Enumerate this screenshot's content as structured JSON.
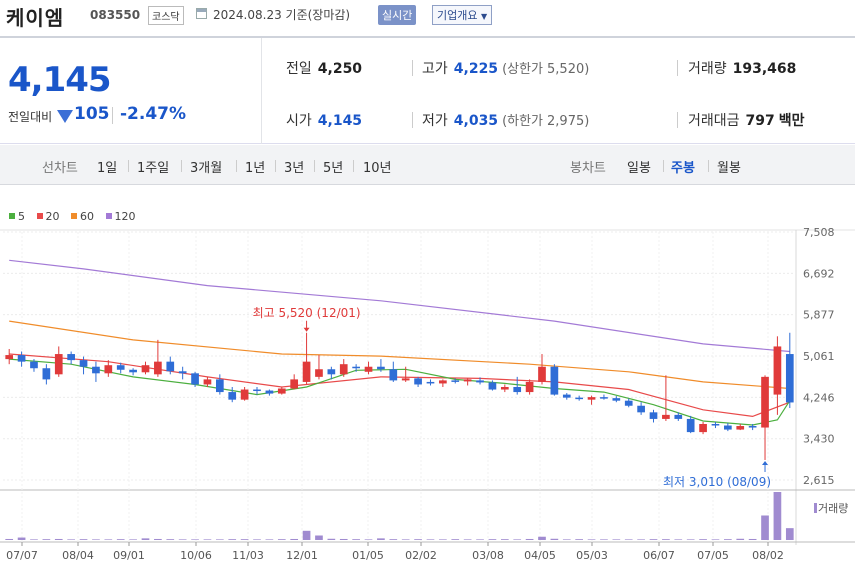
{
  "header": {
    "name": "케이엠",
    "code": "083550",
    "market": "코스닥",
    "date": "2024.08.23",
    "basis": "기준(장마감)",
    "realtime_label": "실시간",
    "company_label": "기업개요"
  },
  "price": {
    "current": "4,145",
    "change_label": "전일대비",
    "change": "105",
    "change_pct": "-2.47%",
    "direction": "down"
  },
  "stats": {
    "prev_label": "전일",
    "prev": "4,250",
    "high_label": "고가",
    "high": "4,225",
    "upper_label": "(상한가",
    "upper": "5,520)",
    "volume_label": "거래량",
    "volume": "193,468",
    "open_label": "시가",
    "open": "4,145",
    "low_label": "저가",
    "low": "4,035",
    "lower_label": "(하한가",
    "lower": "2,975)",
    "amount_label": "거래대금",
    "amount": "797",
    "amount_unit": "백만"
  },
  "periods": {
    "label": "선차트",
    "items": [
      "1일",
      "1주일",
      "3개월",
      "1년",
      "3년",
      "5년",
      "10년"
    ],
    "candle_label": "봉차트",
    "candle_items": [
      "일봉",
      "주봉",
      "월봉"
    ],
    "active_candle": "주봉"
  },
  "colors": {
    "up": "#e03a3a",
    "down": "#2f6dd6",
    "ma5": "#4caf3f",
    "ma20": "#e84a4a",
    "ma60": "#f08c2a",
    "ma120": "#a37ad6",
    "volume": "#a08bd0"
  },
  "chart_data": {
    "type": "candlestick",
    "legend": [
      "5",
      "20",
      "60",
      "120"
    ],
    "y_ticks": [
      "7,508",
      "6,692",
      "5,877",
      "5,061",
      "4,246",
      "3,430",
      "2,615"
    ],
    "y_values": [
      7508,
      6692,
      5877,
      5061,
      4246,
      3430,
      2615
    ],
    "x_ticks": [
      "07/07",
      "08/04",
      "09/01",
      "10/06",
      "11/03",
      "12/01",
      "01/05",
      "02/02",
      "03/08",
      "04/05",
      "05/03",
      "06/07",
      "07/05",
      "08/02"
    ],
    "annotations": {
      "high": "최고 5,520 (12/01)",
      "low": "최저 3,010 (08/09)"
    },
    "volume_label": "거래량",
    "candles": [
      {
        "o": 5000,
        "h": 5200,
        "l": 4900,
        "c": 5080
      },
      {
        "o": 5080,
        "h": 5150,
        "l": 4850,
        "c": 4950
      },
      {
        "o": 4950,
        "h": 5000,
        "l": 4750,
        "c": 4820
      },
      {
        "o": 4820,
        "h": 4900,
        "l": 4500,
        "c": 4600
      },
      {
        "o": 4700,
        "h": 5250,
        "l": 4650,
        "c": 5100
      },
      {
        "o": 5100,
        "h": 5150,
        "l": 4900,
        "c": 4980
      },
      {
        "o": 4980,
        "h": 5050,
        "l": 4700,
        "c": 4850
      },
      {
        "o": 4850,
        "h": 4950,
        "l": 4550,
        "c": 4720
      },
      {
        "o": 4720,
        "h": 4980,
        "l": 4650,
        "c": 4880
      },
      {
        "o": 4880,
        "h": 4930,
        "l": 4720,
        "c": 4790
      },
      {
        "o": 4790,
        "h": 4820,
        "l": 4680,
        "c": 4740
      },
      {
        "o": 4740,
        "h": 4950,
        "l": 4700,
        "c": 4880
      },
      {
        "o": 4700,
        "h": 5380,
        "l": 4650,
        "c": 4950
      },
      {
        "o": 4950,
        "h": 5050,
        "l": 4700,
        "c": 4760
      },
      {
        "o": 4760,
        "h": 4850,
        "l": 4600,
        "c": 4720
      },
      {
        "o": 4720,
        "h": 4750,
        "l": 4450,
        "c": 4500
      },
      {
        "o": 4500,
        "h": 4650,
        "l": 4450,
        "c": 4600
      },
      {
        "o": 4600,
        "h": 4700,
        "l": 4300,
        "c": 4350
      },
      {
        "o": 4350,
        "h": 4450,
        "l": 4150,
        "c": 4200
      },
      {
        "o": 4200,
        "h": 4450,
        "l": 4180,
        "c": 4400
      },
      {
        "o": 4400,
        "h": 4450,
        "l": 4300,
        "c": 4380
      },
      {
        "o": 4380,
        "h": 4400,
        "l": 4280,
        "c": 4320
      },
      {
        "o": 4320,
        "h": 4450,
        "l": 4300,
        "c": 4420
      },
      {
        "o": 4420,
        "h": 4700,
        "l": 4400,
        "c": 4600
      },
      {
        "o": 4550,
        "h": 5520,
        "l": 4500,
        "c": 4950
      },
      {
        "o": 4650,
        "h": 5080,
        "l": 4600,
        "c": 4800
      },
      {
        "o": 4800,
        "h": 4850,
        "l": 4600,
        "c": 4700
      },
      {
        "o": 4700,
        "h": 5000,
        "l": 4650,
        "c": 4900
      },
      {
        "o": 4850,
        "h": 4900,
        "l": 4750,
        "c": 4820
      },
      {
        "o": 4750,
        "h": 4950,
        "l": 4700,
        "c": 4850
      },
      {
        "o": 4850,
        "h": 5000,
        "l": 4750,
        "c": 4800
      },
      {
        "o": 4800,
        "h": 4950,
        "l": 4550,
        "c": 4580
      },
      {
        "o": 4580,
        "h": 4850,
        "l": 4550,
        "c": 4620
      },
      {
        "o": 4620,
        "h": 4650,
        "l": 4450,
        "c": 4500
      },
      {
        "o": 4550,
        "h": 4600,
        "l": 4480,
        "c": 4520
      },
      {
        "o": 4520,
        "h": 4600,
        "l": 4450,
        "c": 4580
      },
      {
        "o": 4580,
        "h": 4620,
        "l": 4520,
        "c": 4560
      },
      {
        "o": 4560,
        "h": 4620,
        "l": 4480,
        "c": 4600
      },
      {
        "o": 4580,
        "h": 4640,
        "l": 4500,
        "c": 4540
      },
      {
        "o": 4540,
        "h": 4580,
        "l": 4380,
        "c": 4400
      },
      {
        "o": 4400,
        "h": 4500,
        "l": 4350,
        "c": 4450
      },
      {
        "o": 4450,
        "h": 4650,
        "l": 4300,
        "c": 4350
      },
      {
        "o": 4350,
        "h": 4600,
        "l": 4300,
        "c": 4550
      },
      {
        "o": 4550,
        "h": 5100,
        "l": 4500,
        "c": 4850
      },
      {
        "o": 4850,
        "h": 4900,
        "l": 4280,
        "c": 4300
      },
      {
        "o": 4300,
        "h": 4330,
        "l": 4200,
        "c": 4240
      },
      {
        "o": 4240,
        "h": 4280,
        "l": 4180,
        "c": 4230
      },
      {
        "o": 4200,
        "h": 4280,
        "l": 4100,
        "c": 4250
      },
      {
        "o": 4250,
        "h": 4300,
        "l": 4200,
        "c": 4230
      },
      {
        "o": 4230,
        "h": 4270,
        "l": 4150,
        "c": 4180
      },
      {
        "o": 4180,
        "h": 4220,
        "l": 4050,
        "c": 4080
      },
      {
        "o": 4080,
        "h": 4150,
        "l": 3900,
        "c": 3950
      },
      {
        "o": 3950,
        "h": 4000,
        "l": 3750,
        "c": 3820
      },
      {
        "o": 3820,
        "h": 4680,
        "l": 3780,
        "c": 3900
      },
      {
        "o": 3900,
        "h": 3950,
        "l": 3780,
        "c": 3820
      },
      {
        "o": 3820,
        "h": 3880,
        "l": 3540,
        "c": 3560
      },
      {
        "o": 3560,
        "h": 3760,
        "l": 3520,
        "c": 3720
      },
      {
        "o": 3720,
        "h": 3760,
        "l": 3640,
        "c": 3690
      },
      {
        "o": 3690,
        "h": 3740,
        "l": 3580,
        "c": 3610
      },
      {
        "o": 3610,
        "h": 3720,
        "l": 3600,
        "c": 3680
      },
      {
        "o": 3680,
        "h": 3720,
        "l": 3600,
        "c": 3650
      },
      {
        "o": 3650,
        "h": 4680,
        "l": 3010,
        "c": 4650
      },
      {
        "o": 4300,
        "h": 5450,
        "l": 3900,
        "c": 5250
      },
      {
        "o": 5100,
        "h": 5520,
        "l": 4035,
        "c": 4145
      }
    ],
    "ma": {
      "ma5": [
        [
          0,
          5000
        ],
        [
          5,
          4900
        ],
        [
          10,
          4650
        ],
        [
          15,
          4500
        ],
        [
          20,
          4300
        ],
        [
          24,
          4450
        ],
        [
          28,
          4780
        ],
        [
          32,
          4800
        ],
        [
          36,
          4600
        ],
        [
          40,
          4520
        ],
        [
          44,
          4420
        ],
        [
          48,
          4350
        ],
        [
          52,
          4100
        ],
        [
          56,
          3780
        ],
        [
          60,
          3700
        ],
        [
          62,
          3800
        ],
        [
          63,
          4180
        ]
      ],
      "ma20": [
        [
          0,
          5100
        ],
        [
          8,
          4950
        ],
        [
          16,
          4650
        ],
        [
          22,
          4450
        ],
        [
          30,
          4650
        ],
        [
          38,
          4620
        ],
        [
          44,
          4550
        ],
        [
          50,
          4400
        ],
        [
          56,
          4000
        ],
        [
          60,
          3870
        ],
        [
          63,
          4150
        ]
      ],
      "ma60": [
        [
          0,
          5750
        ],
        [
          10,
          5380
        ],
        [
          22,
          5100
        ],
        [
          30,
          5060
        ],
        [
          42,
          4900
        ],
        [
          50,
          4750
        ],
        [
          56,
          4550
        ],
        [
          63,
          4420
        ]
      ],
      "ma120": [
        [
          0,
          6950
        ],
        [
          6,
          6780
        ],
        [
          16,
          6450
        ],
        [
          30,
          6150
        ],
        [
          44,
          5750
        ],
        [
          56,
          5300
        ],
        [
          63,
          5150
        ]
      ]
    },
    "volumes": [
      5,
      12,
      3,
      4,
      5,
      3,
      4,
      3,
      3,
      4,
      3,
      8,
      5,
      4,
      3,
      3,
      3,
      3,
      4,
      4,
      3,
      3,
      4,
      5,
      45,
      22,
      6,
      5,
      4,
      3,
      8,
      4,
      3,
      4,
      3,
      3,
      4,
      3,
      3,
      4,
      4,
      3,
      5,
      16,
      6,
      3,
      4,
      3,
      3,
      3,
      3,
      3,
      4,
      4,
      3,
      3,
      4,
      3,
      4,
      6,
      5,
      120,
      235,
      58
    ]
  }
}
